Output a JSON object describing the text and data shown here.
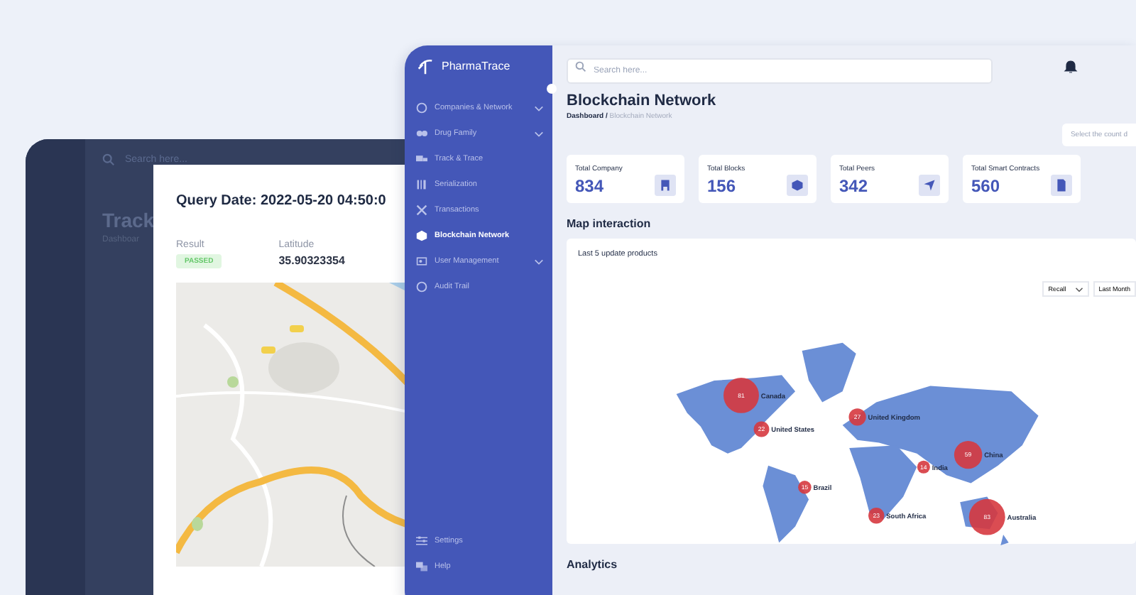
{
  "back_window": {
    "search": {
      "placeholder": "Search here..."
    },
    "title": "Track",
    "breadcrumb": "Dashboar"
  },
  "query_card": {
    "title": "Query Date: 2022-05-20 04:50:0",
    "result_label": "Result",
    "result_badge": "PASSED",
    "latitude_label": "Latitude",
    "latitude": "35.90323354"
  },
  "app": {
    "logo": "PharmaTrace",
    "sidebar": {
      "items": [
        {
          "label": "Companies & Network",
          "expandable": true,
          "selected": false
        },
        {
          "label": "Drug Family",
          "expandable": true,
          "selected": false
        },
        {
          "label": "Track & Trace",
          "expandable": false,
          "selected": false
        },
        {
          "label": "Serialization",
          "expandable": false,
          "selected": false
        },
        {
          "label": "Transactions",
          "expandable": false,
          "selected": false
        },
        {
          "label": "Blockchain Network",
          "expandable": false,
          "selected": true
        },
        {
          "label": "User Management",
          "expandable": true,
          "selected": false
        },
        {
          "label": "Audit Trail",
          "expandable": false,
          "selected": false
        }
      ],
      "footer": [
        {
          "label": "Settings"
        },
        {
          "label": "Help"
        }
      ]
    },
    "search": {
      "placeholder": "Search here..."
    },
    "title": "Blockchain Network",
    "breadcrumb": {
      "root": "Dashboard / ",
      "current": "Blockchain Network"
    },
    "count_select": {
      "placeholder": "Select the count d"
    },
    "stats": [
      {
        "label": "Total Company",
        "value": "834"
      },
      {
        "label": "Total Blocks",
        "value": "156"
      },
      {
        "label": "Total Peers",
        "value": "342"
      },
      {
        "label": "Total Smart Contracts",
        "value": "560"
      }
    ],
    "map_section": {
      "title": "Map interaction",
      "card_title": "Last 5 update products",
      "filters": [
        "Recall",
        "Last Month"
      ],
      "bubbles": [
        {
          "count": "81",
          "country": "Canada"
        },
        {
          "count": "22",
          "country": "United States"
        },
        {
          "count": "27",
          "country": "United Kingdom"
        },
        {
          "count": "14",
          "country": "India"
        },
        {
          "count": "59",
          "country": "China"
        },
        {
          "count": "15",
          "country": "Brazil"
        },
        {
          "count": "23",
          "country": "South Africa"
        },
        {
          "count": "83",
          "country": "Australia"
        }
      ]
    },
    "analytics_title": "Analytics"
  }
}
